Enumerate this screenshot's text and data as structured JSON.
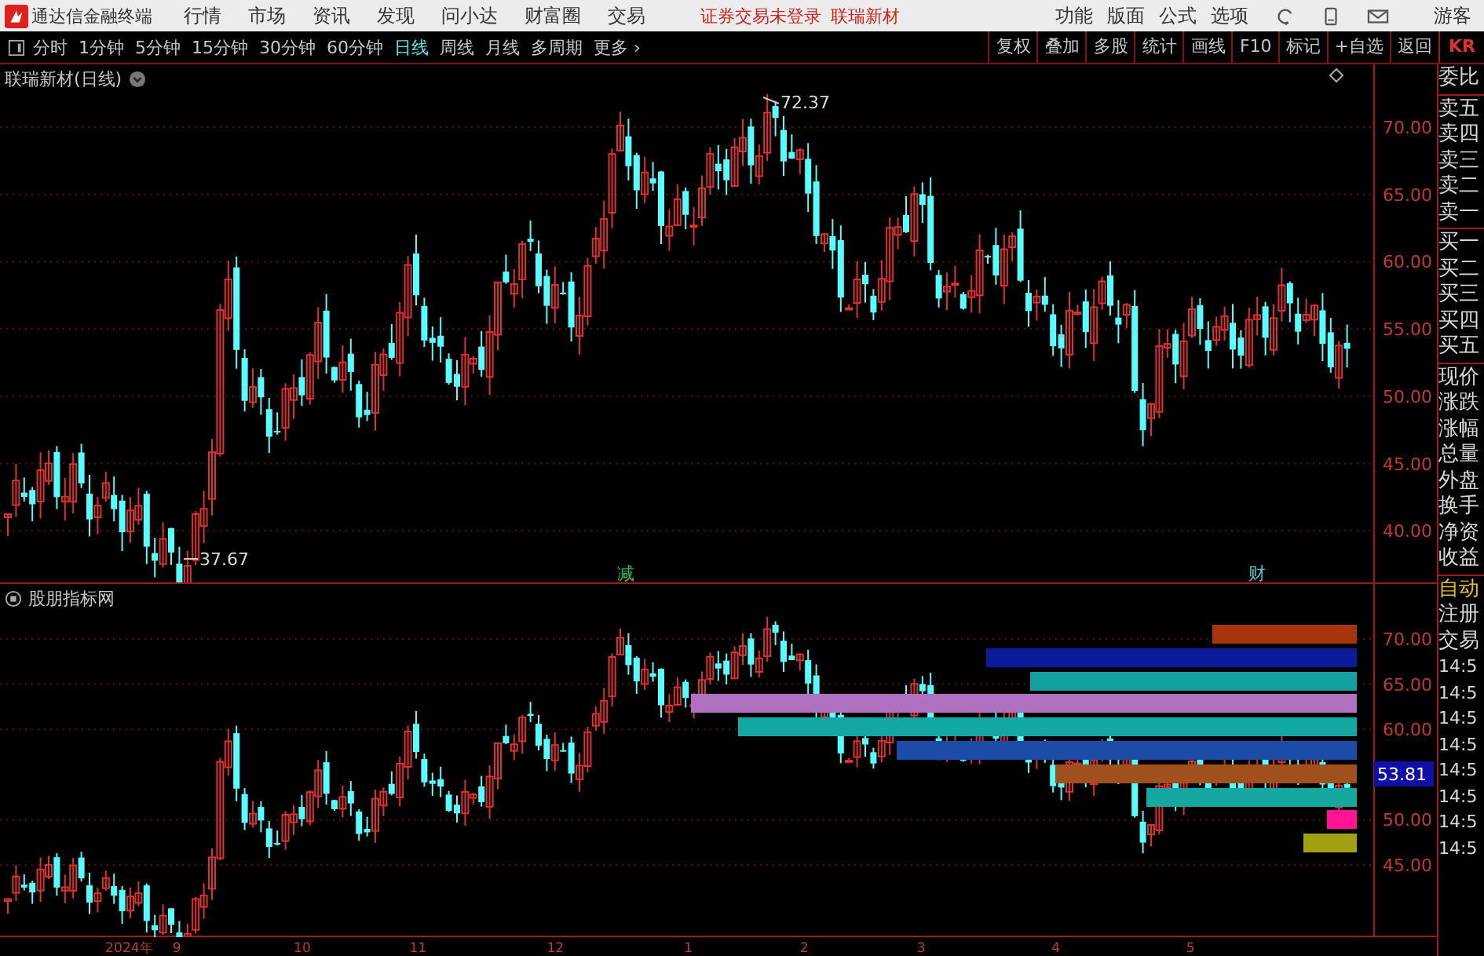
{
  "menu_bar": {
    "app_title": "通达信金融终端",
    "menus": [
      "行情",
      "市场",
      "资讯",
      "发现",
      "问小达",
      "财富圈",
      "交易"
    ],
    "status": "证券交易未登录",
    "stock": "联瑞新材",
    "actions": [
      "功能",
      "版面",
      "公式",
      "选项"
    ],
    "user": "游客"
  },
  "period_tabs": [
    {
      "label": "分时",
      "selected": false
    },
    {
      "label": "1分钟",
      "selected": false
    },
    {
      "label": "5分钟",
      "selected": false
    },
    {
      "label": "15分钟",
      "selected": false
    },
    {
      "label": "30分钟",
      "selected": false
    },
    {
      "label": "60分钟",
      "selected": false
    },
    {
      "label": "日线",
      "selected": true
    },
    {
      "label": "周线",
      "selected": false
    },
    {
      "label": "月线",
      "selected": false
    },
    {
      "label": "多周期",
      "selected": false
    },
    {
      "label": "更多 ›",
      "selected": false
    }
  ],
  "tools": [
    "复权",
    "叠加",
    "多股",
    "统计",
    "画线",
    "F10",
    "标记",
    "+自选",
    "返回"
  ],
  "main_chart": {
    "title": "联瑞新材(日线)",
    "price_ticks": [
      "70.00",
      "65.00",
      "60.00",
      "55.00",
      "50.00",
      "45.00",
      "40.00"
    ],
    "high_label": "72.37",
    "low_label": "37.67",
    "events": [
      {
        "label": "减",
        "color": "#30c060"
      },
      {
        "label": "财",
        "color": "#40c8d0"
      }
    ]
  },
  "indicator": {
    "title": "股朋指标网",
    "price_ticks": [
      "70.00",
      "65.00",
      "60.00",
      "50.00",
      "45.00"
    ],
    "last_price": "53.81",
    "bars": [
      {
        "color": "#a8340e"
      },
      {
        "color": "#0c1a9c"
      },
      {
        "color": "#12a0a0"
      },
      {
        "color": "#b070c0"
      },
      {
        "color": "#14a8a4"
      },
      {
        "color": "#1a4ca8"
      },
      {
        "color": "#a0501c"
      },
      {
        "color": "#16a8a0"
      },
      {
        "color": "#ff1493"
      },
      {
        "color": "#a0a012"
      }
    ]
  },
  "x_axis": [
    "2024年",
    "9",
    "10",
    "11",
    "12",
    "1",
    "2",
    "3",
    "4",
    "5"
  ],
  "quote_panel": {
    "header": "KR",
    "groups": [
      [
        "委比"
      ],
      [
        "卖五",
        "卖四",
        "卖三",
        "卖二",
        "卖一"
      ],
      [
        "买一",
        "买二",
        "买三",
        "买四",
        "买五"
      ],
      [
        "现价",
        "涨跌",
        "涨幅",
        "总量",
        "外盘",
        "换手",
        "净资",
        "收益"
      ]
    ],
    "lower": [
      {
        "kind": "mode",
        "label": "自动"
      },
      {
        "kind": "label",
        "label": "注册"
      },
      {
        "kind": "label",
        "label": "交易"
      },
      {
        "kind": "time",
        "label": "14:5"
      },
      {
        "kind": "time",
        "label": "14:5"
      },
      {
        "kind": "time",
        "label": "14:5"
      },
      {
        "kind": "time",
        "label": "14:5"
      },
      {
        "kind": "time",
        "label": "14:5"
      },
      {
        "kind": "time",
        "label": "14:5"
      },
      {
        "kind": "time",
        "label": "14:5"
      },
      {
        "kind": "time",
        "label": "14:5"
      }
    ]
  }
}
